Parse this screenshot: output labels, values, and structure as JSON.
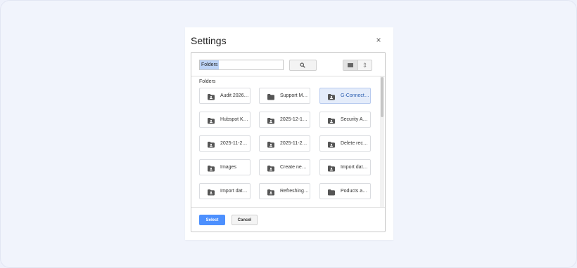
{
  "dialog": {
    "title": "Settings",
    "close_glyph": "×"
  },
  "toolbar": {
    "search_value": "Folders"
  },
  "section_label": "Folders",
  "folders": [
    {
      "name": "Audit 2026…",
      "icon": "shared-folder-icon"
    },
    {
      "name": "Support M…",
      "icon": "folder-icon"
    },
    {
      "name": "G-Connect…",
      "icon": "shared-folder-icon",
      "selected": true
    },
    {
      "name": "Hubspot K…",
      "icon": "shared-folder-icon"
    },
    {
      "name": "2025-12-1…",
      "icon": "shared-folder-icon"
    },
    {
      "name": "Security A…",
      "icon": "shared-folder-icon"
    },
    {
      "name": "2025-11-2…",
      "icon": "shared-folder-icon"
    },
    {
      "name": "2025-11-2…",
      "icon": "shared-folder-icon"
    },
    {
      "name": "Delete rec…",
      "icon": "shared-folder-icon"
    },
    {
      "name": "Images",
      "icon": "shared-folder-icon"
    },
    {
      "name": "Create ne…",
      "icon": "shared-folder-icon"
    },
    {
      "name": "Import dat…",
      "icon": "shared-folder-icon"
    },
    {
      "name": "Import dat…",
      "icon": "shared-folder-icon"
    },
    {
      "name": "Refreshing…",
      "icon": "shared-folder-icon"
    },
    {
      "name": "Poducts a…",
      "icon": "folder-icon"
    }
  ],
  "footer": {
    "select_label": "Select",
    "cancel_label": "Cancel"
  },
  "colors": {
    "primary": "#4d90fe",
    "selected_bg": "#e4ecfa",
    "search_highlight": "#bcd3f7"
  }
}
